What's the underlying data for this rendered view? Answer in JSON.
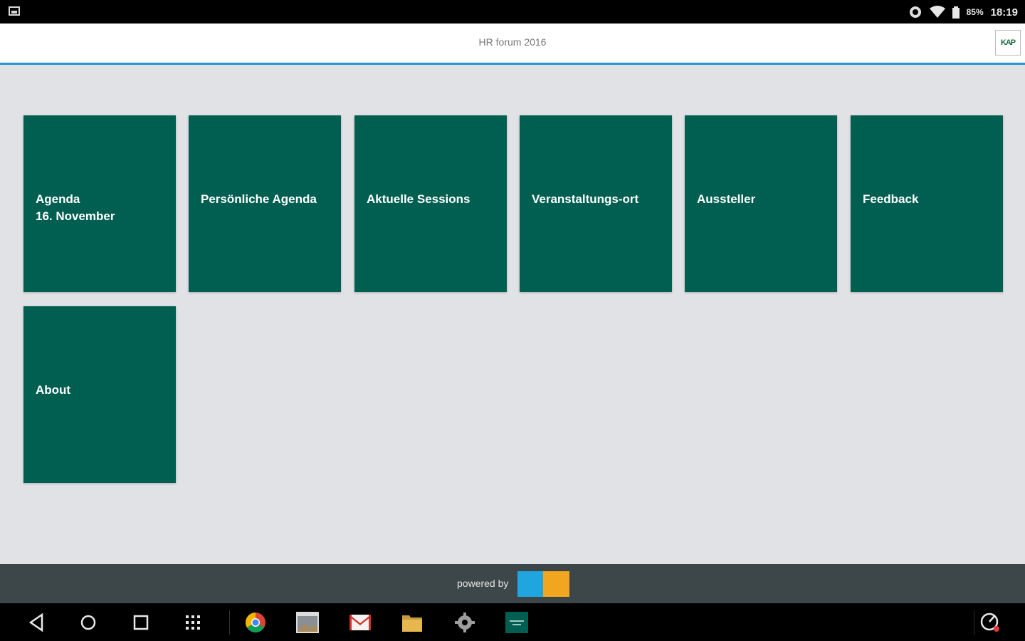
{
  "status_bar": {
    "battery_percent": "85%",
    "time": "18:19"
  },
  "header": {
    "title": "HR forum 2016",
    "logo_text": "KAP"
  },
  "tiles": [
    {
      "label": "Agenda\n16. November"
    },
    {
      "label": "Persönliche Agenda"
    },
    {
      "label": "Aktuelle Sessions"
    },
    {
      "label": "Veranstaltungs-ort"
    },
    {
      "label": "Aussteller"
    },
    {
      "label": "Feedback"
    },
    {
      "label": "About"
    }
  ],
  "footer": {
    "powered_by": "powered by"
  },
  "colors": {
    "tile": "#005f50",
    "header_accent": "#2196d8",
    "background": "#e1e2e6",
    "footer": "#3d4648"
  },
  "nav_icons": [
    "back-icon",
    "home-icon",
    "recents-icon",
    "app-drawer-icon",
    "chrome-icon",
    "gallery-icon",
    "gmail-icon",
    "files-icon",
    "settings-icon",
    "hr-forum-app-icon",
    "speed-icon"
  ]
}
